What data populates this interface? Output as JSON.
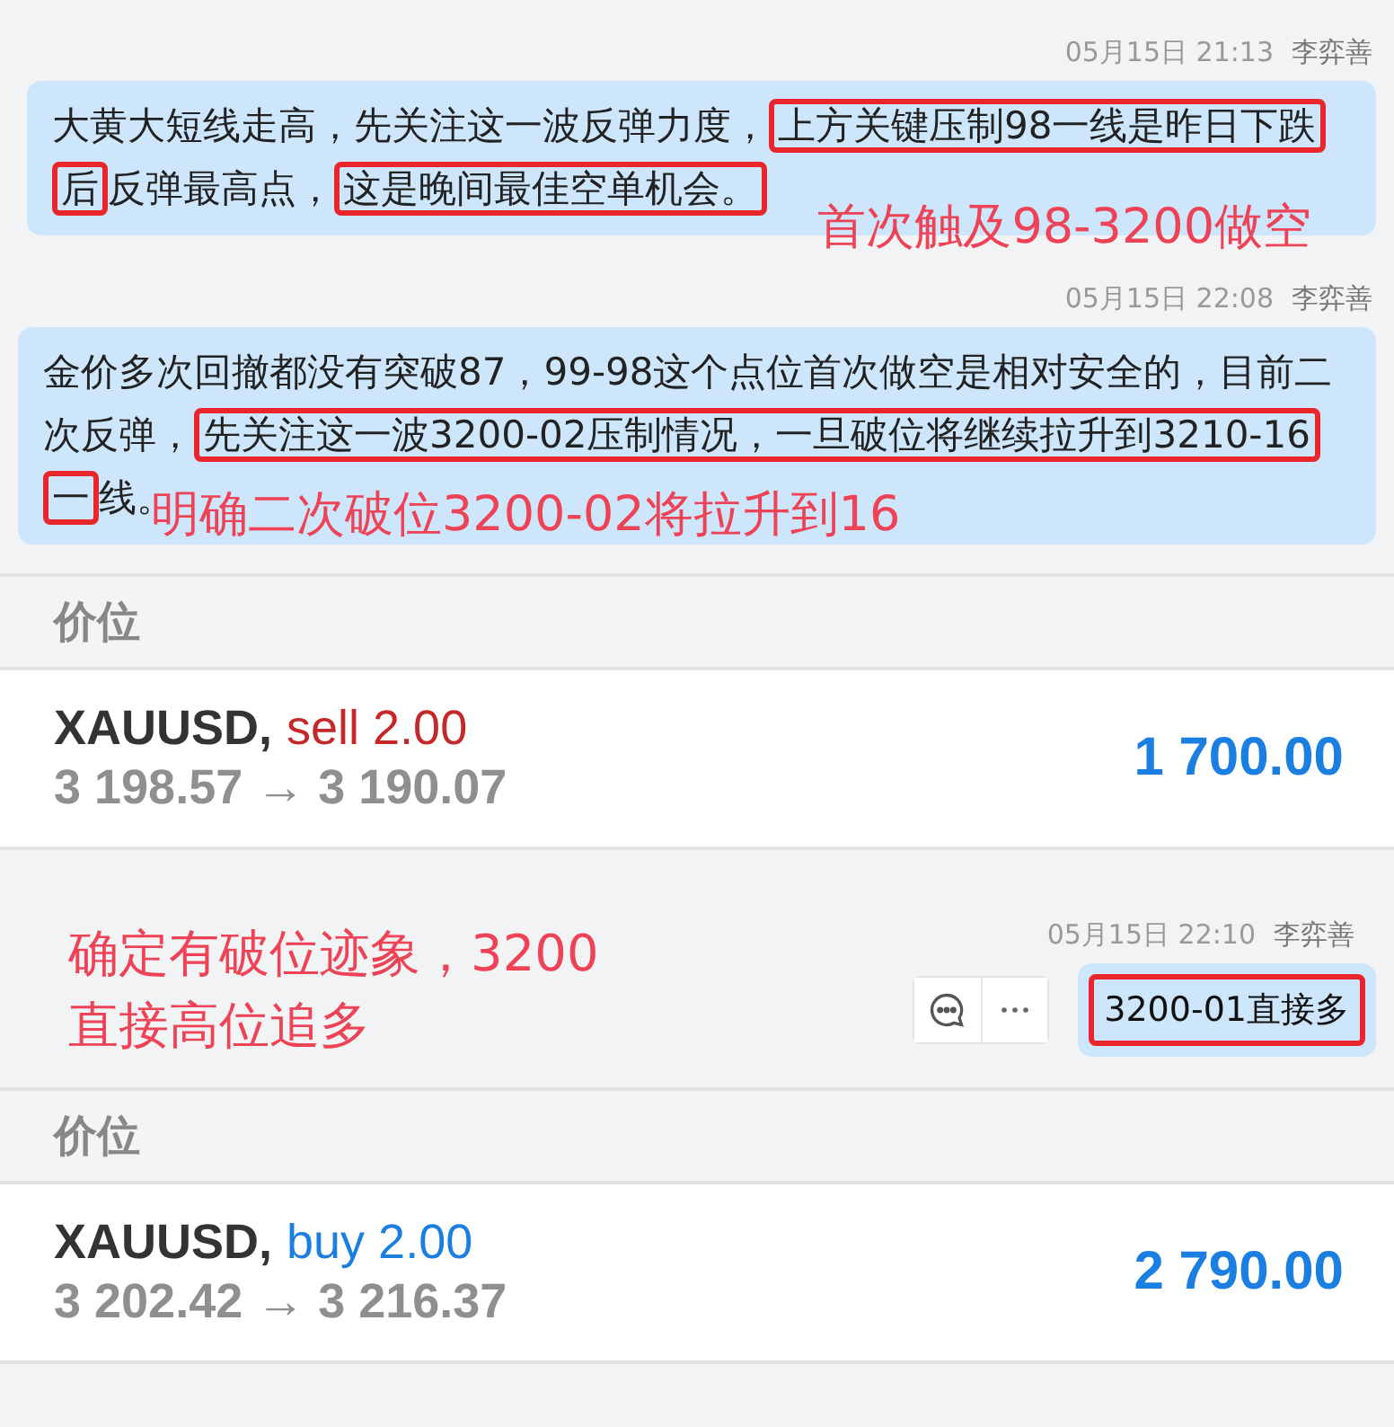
{
  "feed": [
    {
      "kind": "message",
      "time": "05月15日 21:13",
      "author": "李弈善",
      "segments": [
        {
          "text": "大黄大短线走高，先关注这一波反弹力度，",
          "boxed": false
        },
        {
          "text": "上方关键压制98一线是昨日下跌后",
          "boxed": true
        },
        {
          "text": "反弹最高点，",
          "boxed": false
        },
        {
          "text": "这是晚间最佳空单机会。",
          "boxed": true
        }
      ],
      "annotation": {
        "text": "首次触及98-3200做空"
      }
    },
    {
      "kind": "message",
      "time": "05月15日 22:08",
      "author": "李弈善",
      "segments": [
        {
          "text": "金价多次回撤都没有突破87，99-98这个点位首次做空是相对安全的，目前二次反弹，",
          "boxed": false
        },
        {
          "text": "先关注这一波3200-02压制情况，一旦破位将继续拉升到3210-16一",
          "boxed": true
        },
        {
          "text": "线。",
          "boxed": false
        }
      ],
      "annotation": {
        "text": "明确二次破位3200-02将拉升到16"
      }
    },
    {
      "kind": "trade",
      "header": "价位",
      "symbol": "XAUUSD,",
      "color": "#c42828",
      "order": "sell 2.00",
      "prices": "3 198.57 → 3 190.07",
      "profit": "1 700.00"
    },
    {
      "kind": "short",
      "time": "05月15日 22:10",
      "author": "李弈善",
      "segments": [
        {
          "text": "3200-01直接多",
          "boxed": true
        }
      ],
      "annotation": {
        "text": "确定有破位迹象，3200 直接高位追多"
      }
    },
    {
      "kind": "trade",
      "header": "价位",
      "symbol": "XAUUSD,",
      "color": "#1a7fe0",
      "order": "buy 2.00",
      "prices": "3 202.42 → 3 216.37",
      "profit": "2 790.00"
    }
  ]
}
